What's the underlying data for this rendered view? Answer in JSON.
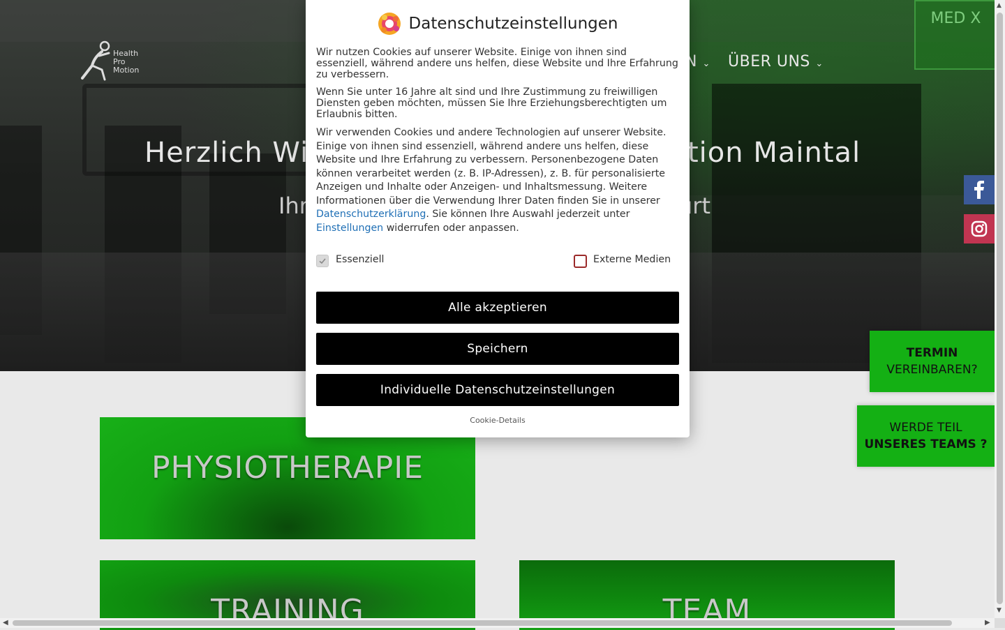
{
  "header": {
    "logo_text": [
      "Health",
      "Pro",
      "Motion"
    ],
    "nav": [
      {
        "label": "N",
        "has_dropdown": true
      },
      {
        "label": "ÜBER UNS",
        "has_dropdown": true
      }
    ]
  },
  "hero": {
    "title_left": "Herzlich Wi",
    "title_right": "tion Maintal",
    "subtitle_left": "Ihr",
    "subtitle_right": "urt",
    "wall_sign": "MED X"
  },
  "social": [
    {
      "name": "facebook",
      "icon": "facebook-icon",
      "color": "#3b5998"
    },
    {
      "name": "instagram",
      "icon": "instagram-icon",
      "color": "#c13551"
    }
  ],
  "cta": {
    "appointment": {
      "line1": "TERMIN",
      "line2": "VEREINBAREN?"
    },
    "team": {
      "line1": "WERDE TEIL",
      "line2": "UNSERES TEAMS ?"
    },
    "color": "#14b014"
  },
  "cards": {
    "physio": "PHYSIOTHERAPIE",
    "training": "TRAINING",
    "team": "TEAM"
  },
  "consent": {
    "title": "Datenschutzeinstellungen",
    "p1": "Wir nutzen Cookies auf unserer Website. Einige von ihnen sind essenziell, während andere uns helfen, diese Website und Ihre Erfahrung zu verbessern.",
    "p2": "Wenn Sie unter 16 Jahre alt sind und Ihre Zustimmung zu freiwilligen Diensten geben möchten, müssen Sie Ihre Erziehungsberechtigten um Erlaubnis bitten.",
    "p3_a": "Wir verwenden Cookies und andere Technologien auf unserer Website. Einige von ihnen sind essenziell, während andere uns helfen, diese Website und Ihre Erfahrung zu verbessern. Personenbezogene Daten können verarbeitet werden (z. B. IP-Adressen), z. B. für personalisierte Anzeigen und Inhalte oder Anzeigen- und Inhaltsmessung. Weitere Informationen über die Verwendung Ihrer Daten finden Sie in unserer ",
    "p3_link1": "Datenschutzerklärung",
    "p3_b": ". Sie können Ihre Auswahl jederzeit unter ",
    "p3_link2": "Einstellungen",
    "p3_c": " widerrufen oder anpassen.",
    "checkbox_essential": {
      "label": "Essenziell",
      "checked": true
    },
    "checkbox_external": {
      "label": "Externe Medien",
      "checked": false
    },
    "btn_accept_all": "Alle akzeptieren",
    "btn_save": "Speichern",
    "btn_individual": "Individuelle Datenschutzeinstellungen",
    "cookie_details": "Cookie-Details",
    "link_color": "#1f6fb5"
  }
}
